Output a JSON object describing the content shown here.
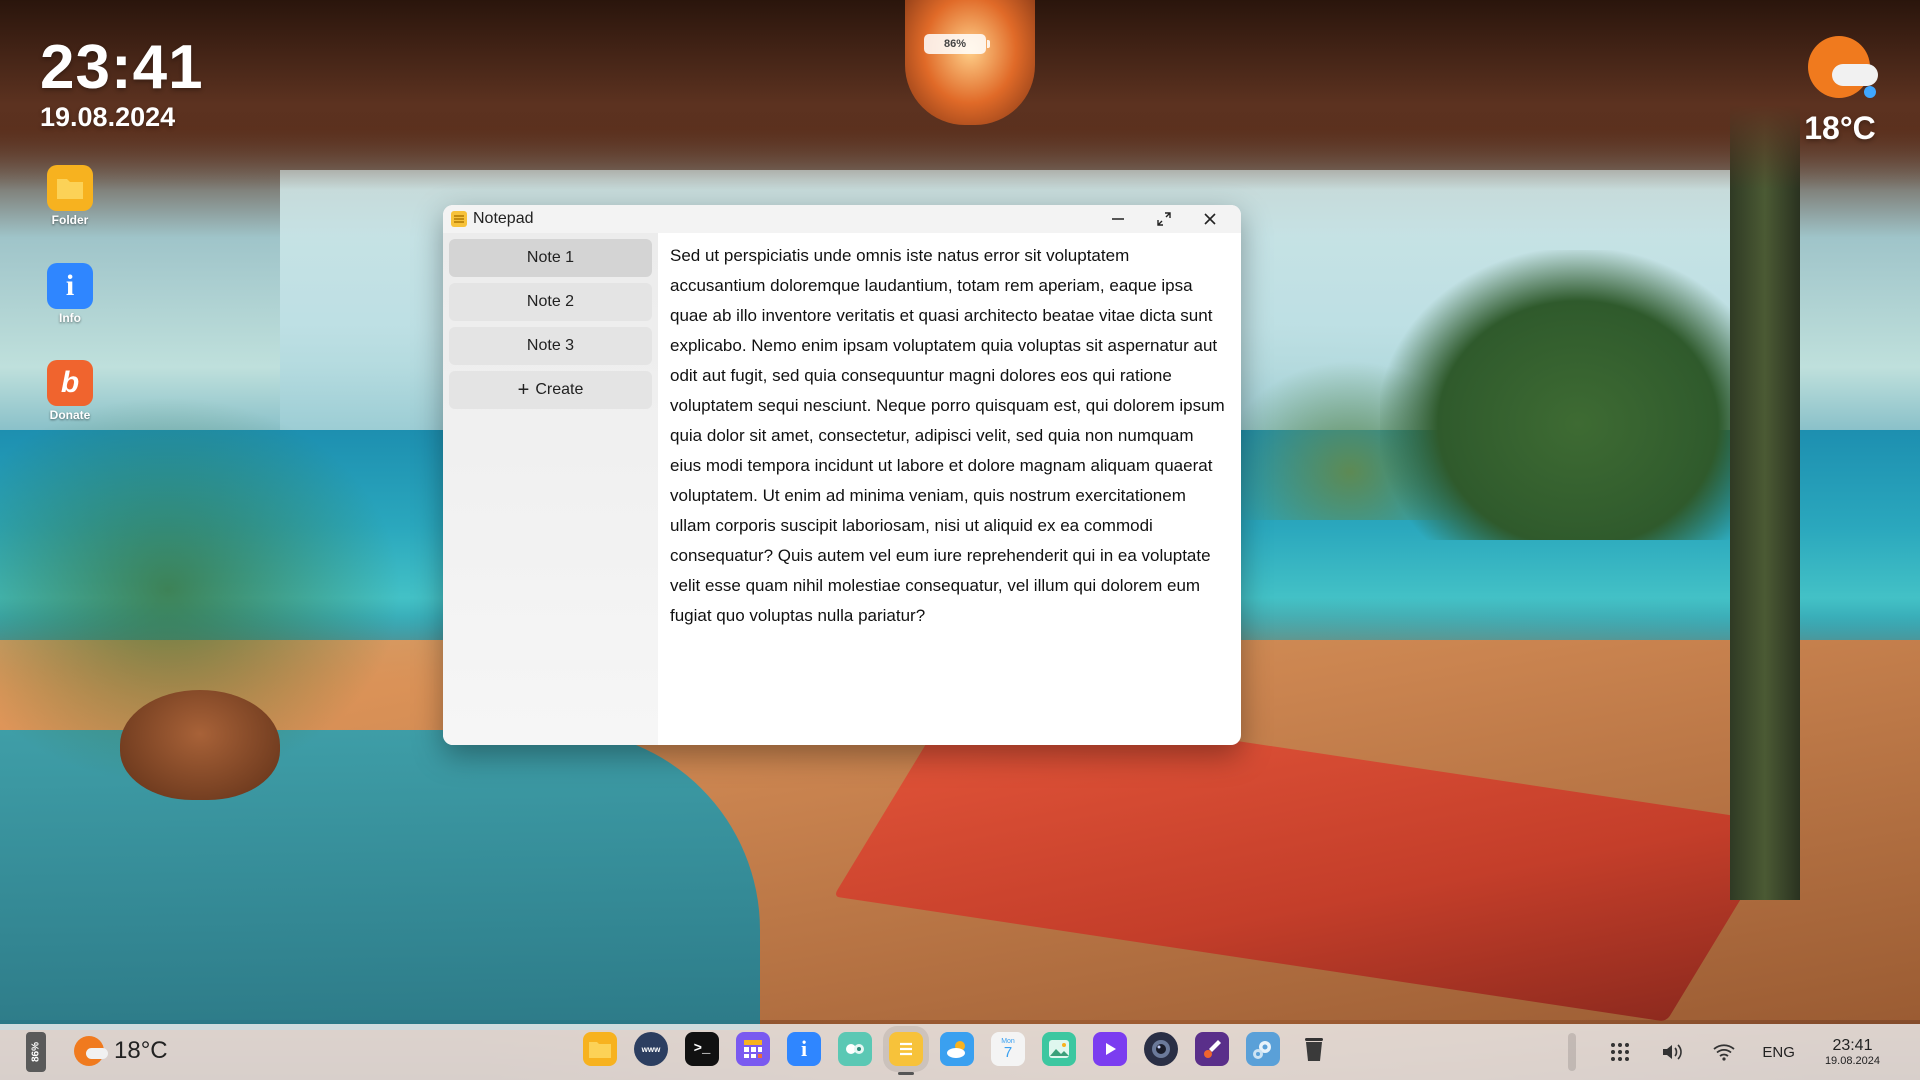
{
  "desktop": {
    "clock": {
      "time": "23:41",
      "date": "19.08.2024"
    },
    "battery_label": "86%",
    "weather": {
      "temp": "18°C",
      "icon": "partly-cloudy-icon"
    },
    "icons": [
      {
        "label": "Folder",
        "icon": "folder-icon",
        "color": "#f7b21f"
      },
      {
        "label": "Info",
        "icon": "info-icon",
        "color": "#2f86ff"
      },
      {
        "label": "Donate",
        "icon": "donate-icon",
        "color": "#f0642e"
      }
    ]
  },
  "notepad": {
    "title": "Notepad",
    "notes": [
      "Note 1",
      "Note 2",
      "Note 3"
    ],
    "active_note": "Note 1",
    "create_label": "Create",
    "text": "Sed ut perspiciatis unde omnis iste natus error sit voluptatem accusantium doloremque laudantium, totam rem aperiam, eaque ipsa quae ab illo inventore veritatis et quasi architecto beatae vitae dicta sunt explicabo. Nemo enim ipsam voluptatem quia voluptas sit aspernatur aut odit aut fugit, sed quia consequuntur magni dolores eos qui ratione voluptatem sequi nesciunt. Neque porro quisquam est, qui dolorem ipsum quia dolor sit amet, consectetur, adipisci velit, sed quia non numquam eius modi tempora incidunt ut labore et dolore magnam aliquam quaerat voluptatem. Ut enim ad minima veniam, quis nostrum exercitationem ullam corporis suscipit laboriosam, nisi ut aliquid ex ea commodi consequatur? Quis autem vel eum iure reprehenderit qui in ea voluptate velit esse quam nihil molestiae consequatur, vel illum qui dolorem eum fugiat quo voluptas nulla pariatur?"
  },
  "taskbar": {
    "battery": "86%",
    "weather_temp": "18°C",
    "dock": [
      {
        "name": "files",
        "icon": "folder-icon",
        "color": "#f7b21f"
      },
      {
        "name": "browser",
        "icon": "globe-icon",
        "color": "#2c3e60"
      },
      {
        "name": "terminal",
        "icon": "terminal-icon",
        "color": "#111111"
      },
      {
        "name": "calculator",
        "icon": "calculator-icon",
        "color": "#7a5af0"
      },
      {
        "name": "info",
        "icon": "info-icon",
        "color": "#2f86ff"
      },
      {
        "name": "games",
        "icon": "gamepad-icon",
        "color": "#5bc8b4"
      },
      {
        "name": "notepad",
        "icon": "notepad-icon",
        "color": "#f7c23a",
        "active": true
      },
      {
        "name": "weather",
        "icon": "weather-icon",
        "color": "#3aa0f0"
      },
      {
        "name": "calendar",
        "icon": "calendar-icon",
        "color": "#f4f4f4"
      },
      {
        "name": "photos",
        "icon": "photos-icon",
        "color": "#3cc7a0"
      },
      {
        "name": "video",
        "icon": "play-icon",
        "color": "#7b3df0"
      },
      {
        "name": "camera",
        "icon": "camera-icon",
        "color": "#2a2f45"
      },
      {
        "name": "paint",
        "icon": "paint-icon",
        "color": "#5a2f8a"
      },
      {
        "name": "settings",
        "icon": "gear-icon",
        "color": "#5aa0d8"
      },
      {
        "name": "trash",
        "icon": "trash-icon",
        "color": "#3a3a3a"
      }
    ],
    "calendar": {
      "month": "Mon",
      "day": "7"
    },
    "lang": "ENG",
    "clock_time": "23:41",
    "clock_date": "19.08.2024"
  }
}
